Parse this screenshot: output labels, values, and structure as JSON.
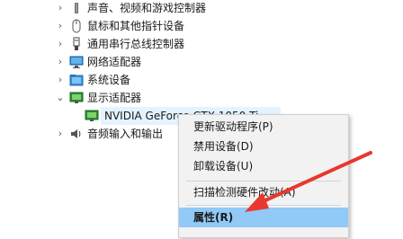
{
  "tree": {
    "rows": [
      {
        "label": "声音、视频和游戏控制器",
        "icon": "speaker-icon",
        "expanded": false
      },
      {
        "label": "鼠标和其他指针设备",
        "icon": "mouse-icon",
        "expanded": false
      },
      {
        "label": "通用串行总线控制器",
        "icon": "usb-icon",
        "expanded": false
      },
      {
        "label": "网络适配器",
        "icon": "network-icon",
        "expanded": false
      },
      {
        "label": "系统设备",
        "icon": "system-folder-icon",
        "expanded": false
      },
      {
        "label": "显示适配器",
        "icon": "display-adapter-icon",
        "expanded": true
      },
      {
        "label": "NVIDIA GeForce GTX 1050 Ti",
        "icon": "display-adapter-icon",
        "child": true
      },
      {
        "label": "音频输入和输出",
        "icon": "audio-io-icon",
        "expanded": false
      }
    ]
  },
  "context_menu": {
    "items": [
      {
        "label": "更新驱动程序(P)"
      },
      {
        "label": "禁用设备(D)"
      },
      {
        "label": "卸载设备(U)"
      },
      {
        "label": "扫描检测硬件改动(A)"
      },
      {
        "label": "属性(R)",
        "highlighted": true
      }
    ]
  },
  "colors": {
    "accent_arrow": "#e8382f",
    "menu_highlight": "#91c9f7",
    "selection": "#e5f3ff"
  }
}
